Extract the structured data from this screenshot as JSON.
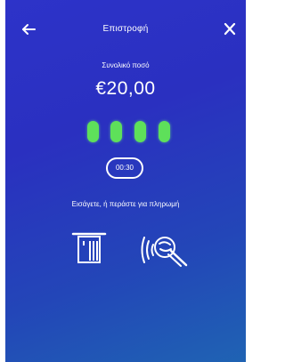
{
  "header": {
    "title": "Επιστροφή",
    "back_icon": "back-arrow-icon",
    "close_icon": "close-icon"
  },
  "payment": {
    "amount_label": "Συνολικό ποσό",
    "amount": "€20,00",
    "pin_dots_entered": 4,
    "pin_dot_color": "#5ee05a",
    "timer": "00:30",
    "prompt": "Εισάγετε, ή περάστε για πληρωμή"
  },
  "icons": {
    "card_insert": "card-insert-icon",
    "contactless": "contactless-tap-icon"
  },
  "colors": {
    "background_top": "#2d33c9",
    "background_bottom": "#1f63b3",
    "foreground": "#ffffff"
  }
}
